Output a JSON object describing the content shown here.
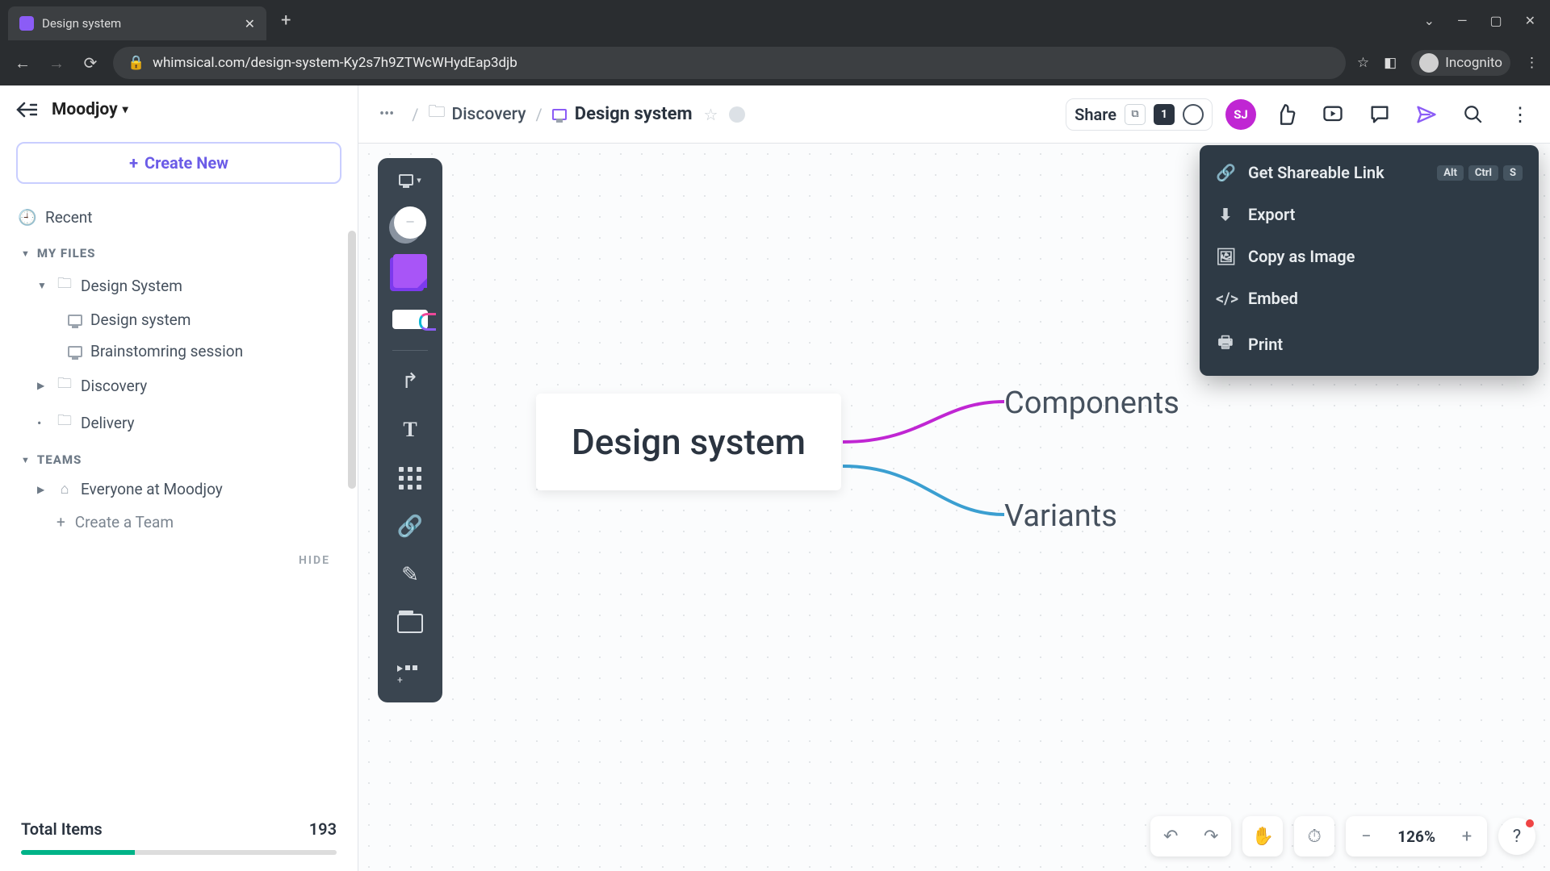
{
  "browser": {
    "tab_title": "Design system",
    "url": "whimsical.com/design-system-Ky2s7h9ZTWcWHydEap3djb",
    "profile": "Incognito"
  },
  "sidebar": {
    "workspace": "Moodjoy",
    "create_label": "Create New",
    "recent": "Recent",
    "my_files_label": "MY FILES",
    "teams_label": "TEAMS",
    "tree": {
      "design_system_folder": "Design System",
      "design_system_board": "Design system",
      "brainstorming": "Brainstomring session",
      "discovery": "Discovery",
      "delivery": "Delivery"
    },
    "team_item": "Everyone at Moodjoy",
    "create_team": "Create a Team",
    "hide": "HIDE",
    "total_items_label": "Total Items",
    "total_items_value": "193"
  },
  "topbar": {
    "crumb_parent": "Discovery",
    "crumb_current": "Design system",
    "share": "Share",
    "badge_count": "1",
    "avatar": "SJ"
  },
  "menu": {
    "shareable": "Get Shareable Link",
    "shareable_keys": [
      "Alt",
      "Ctrl",
      "S"
    ],
    "export": "Export",
    "copy_image": "Copy as Image",
    "embed": "Embed",
    "print": "Print"
  },
  "canvas": {
    "root": "Design system",
    "child_a": "Components",
    "child_b": "Variants"
  },
  "footer": {
    "zoom": "126%"
  }
}
